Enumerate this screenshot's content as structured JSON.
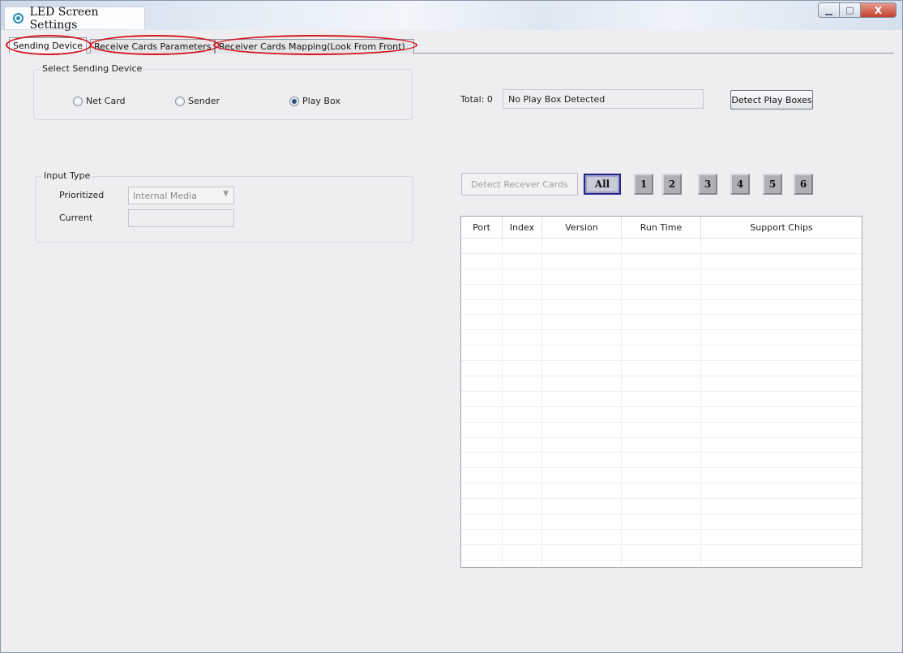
{
  "window": {
    "title": "LED Screen Settings",
    "controls": {
      "minimize": "▁",
      "maximize": "▢",
      "close": "X"
    }
  },
  "tabs": [
    {
      "label": "Sending Device",
      "active": true
    },
    {
      "label": "Receive Cards Parameters",
      "active": false
    },
    {
      "label": "Receiver Cards Mapping(Look From Front)",
      "active": false
    }
  ],
  "select_sending_device": {
    "legend": "Select Sending Device",
    "options": [
      {
        "label": "Net Card",
        "checked": false
      },
      {
        "label": "Sender",
        "checked": false
      },
      {
        "label": "Play Box",
        "checked": true
      }
    ]
  },
  "detection": {
    "total_label": "Total: 0",
    "status": "No Play Box Detected",
    "detect_button": "Detect Play Boxes"
  },
  "input_type": {
    "legend": "Input Type",
    "prioritized_label": "Prioritized",
    "prioritized_value": "Internal Media",
    "current_label": "Current",
    "current_value": ""
  },
  "receiver_cards": {
    "detect_button": "Detect Recever Cards",
    "port_buttons": [
      "All",
      "1",
      "2",
      "3",
      "4",
      "5",
      "6"
    ],
    "selected_port": "All"
  },
  "table": {
    "columns": [
      "Port",
      "Index",
      "Version",
      "Run Time",
      "Support Chips"
    ],
    "rows": []
  },
  "colors": {
    "annotation": "#d4121d",
    "selected_port_border": "#23238c"
  }
}
